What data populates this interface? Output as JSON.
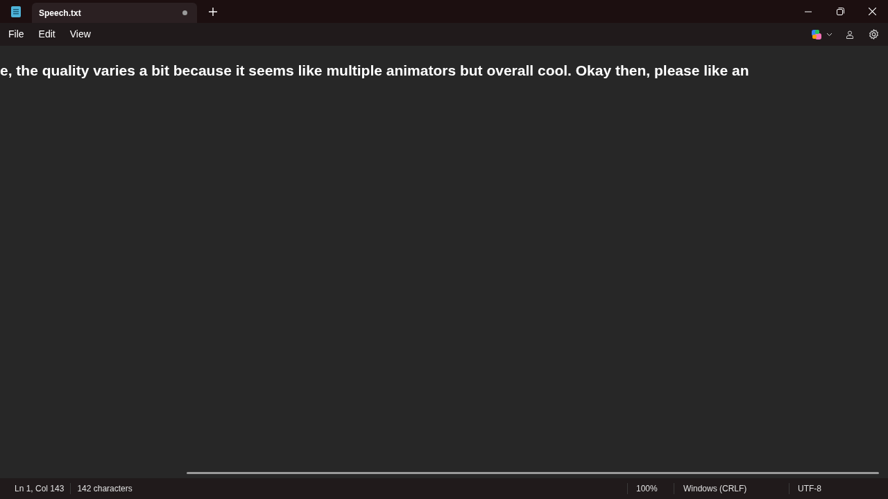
{
  "tabs": [
    {
      "title": "Speech.txt",
      "selected": true,
      "unsaved": true
    }
  ],
  "menu": [
    "File",
    "Edit",
    "View"
  ],
  "editor": {
    "text": "e, the quality varies a bit because it seems like multiple animators but overall cool. Okay then, please like an"
  },
  "status_bar": {
    "position": "Ln 1, Col 143",
    "characters": "142 characters",
    "zoom": "100%",
    "line_ending": "Windows (CRLF)",
    "encoding": "UTF-8"
  }
}
